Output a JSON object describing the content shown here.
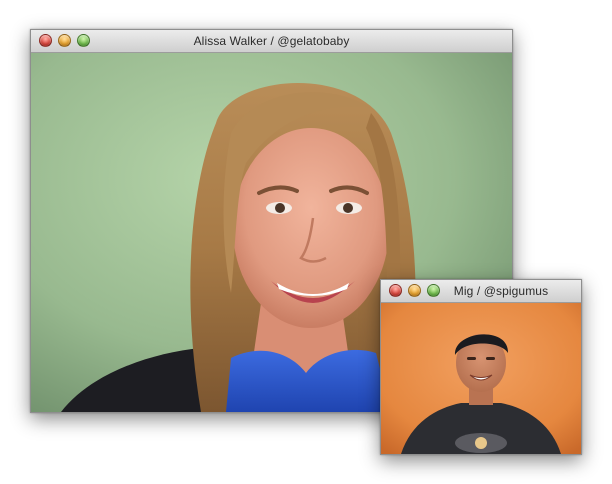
{
  "main_window": {
    "title": "Alissa Walker / @gelatobaby"
  },
  "inset_window": {
    "title": "Mig / @spigumus"
  },
  "colors": {
    "main_video_background": "#9cbf95",
    "inset_video_background": "#e9894a"
  },
  "icons": {
    "close": "close-icon",
    "minimize": "minimize-icon",
    "zoom": "zoom-icon"
  }
}
